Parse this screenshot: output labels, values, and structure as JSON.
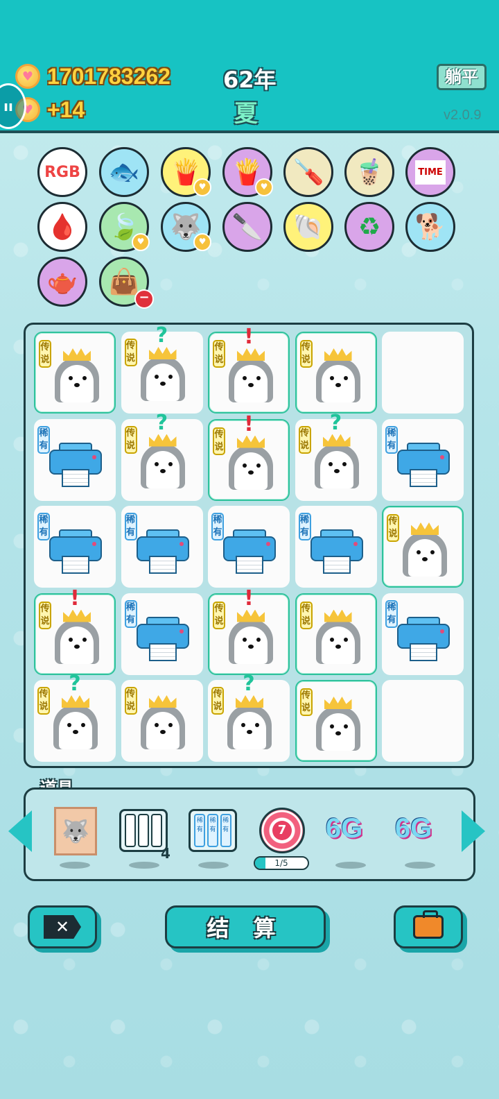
{
  "header": {
    "coins": "1701783262",
    "income": "+14",
    "year": "62年",
    "season": "夏",
    "lie_flat_label": "躺平",
    "version": "v2.0.9"
  },
  "items_row1": [
    {
      "name": "rgb",
      "text": "RGB",
      "bg": "#ffffff"
    },
    {
      "name": "fishbowl",
      "text": "🐟",
      "bg": "#9fe4f5"
    },
    {
      "name": "fries",
      "text": "🍟",
      "bg": "#fff27a"
    },
    {
      "name": "fries-purple",
      "text": "🍟",
      "bg": "#d9a5e9"
    },
    {
      "name": "screwdriver",
      "text": "🪛",
      "bg": "#f1e9c0"
    },
    {
      "name": "bubble-tea",
      "text": "🧋",
      "bg": "#f1e9c0"
    },
    {
      "name": "time-magazine",
      "text": "TIME",
      "bg": "#d9a5e9"
    }
  ],
  "items_row2": [
    {
      "name": "blood-bag",
      "text": "🩸",
      "bg": "#ffffff"
    },
    {
      "name": "leaf",
      "text": "🍃",
      "bg": "#a8e8b0"
    },
    {
      "name": "husky-figure",
      "text": "🐺",
      "bg": "#9fe4f5"
    },
    {
      "name": "cleaver",
      "text": "🔪",
      "bg": "#d9a5e9"
    },
    {
      "name": "shell",
      "text": "🐚",
      "bg": "#fff27a"
    },
    {
      "name": "recycle",
      "text": "♻",
      "bg": "#d9a5e9"
    },
    {
      "name": "cool-dog",
      "text": "🐕",
      "bg": "#9fe4f5"
    }
  ],
  "items_row3": [
    {
      "name": "gravy-boat",
      "text": "🫖",
      "bg": "#d9a5e9"
    },
    {
      "name": "sack",
      "text": "👜",
      "bg": "#a8e8b0"
    }
  ],
  "labels": {
    "legend": "传说",
    "rare": "稀有",
    "question": "?",
    "exclaim": "!"
  },
  "grid": [
    [
      {
        "t": "husky",
        "tag": "legend",
        "hl": true
      },
      {
        "t": "husky",
        "tag": "legend",
        "mark": "q"
      },
      {
        "t": "husky",
        "tag": "legend",
        "hl": true,
        "mark": "e"
      },
      {
        "t": "husky",
        "tag": "legend",
        "hl": true
      },
      {
        "t": "empty"
      }
    ],
    [
      {
        "t": "printer",
        "tag": "rare"
      },
      {
        "t": "husky",
        "tag": "legend",
        "mark": "q"
      },
      {
        "t": "husky",
        "tag": "legend",
        "hl": true,
        "mark": "e"
      },
      {
        "t": "husky",
        "tag": "legend",
        "mark": "q"
      },
      {
        "t": "printer",
        "tag": "rare"
      }
    ],
    [
      {
        "t": "printer",
        "tag": "rare"
      },
      {
        "t": "printer",
        "tag": "rare"
      },
      {
        "t": "printer",
        "tag": "rare"
      },
      {
        "t": "printer",
        "tag": "rare"
      },
      {
        "t": "husky",
        "tag": "legend",
        "hl": true
      }
    ],
    [
      {
        "t": "husky",
        "tag": "legend",
        "hl": true,
        "mark": "e"
      },
      {
        "t": "printer",
        "tag": "rare"
      },
      {
        "t": "husky",
        "tag": "legend",
        "hl": true,
        "mark": "e"
      },
      {
        "t": "husky",
        "tag": "legend",
        "hl": true
      },
      {
        "t": "printer",
        "tag": "rare"
      }
    ],
    [
      {
        "t": "husky",
        "tag": "legend",
        "mark": "q"
      },
      {
        "t": "husky",
        "tag": "legend"
      },
      {
        "t": "husky",
        "tag": "legend",
        "mark": "q"
      },
      {
        "t": "husky",
        "tag": "legend",
        "hl": true
      },
      {
        "t": "empty"
      }
    ]
  ],
  "props": {
    "title": "道具",
    "slots_count": "4",
    "target_number": "7",
    "progress_text": "1/5",
    "progress_fraction": 0.2,
    "sixg_1": "6G",
    "sixg_2": "6G"
  },
  "buttons": {
    "settle": "结 算"
  }
}
